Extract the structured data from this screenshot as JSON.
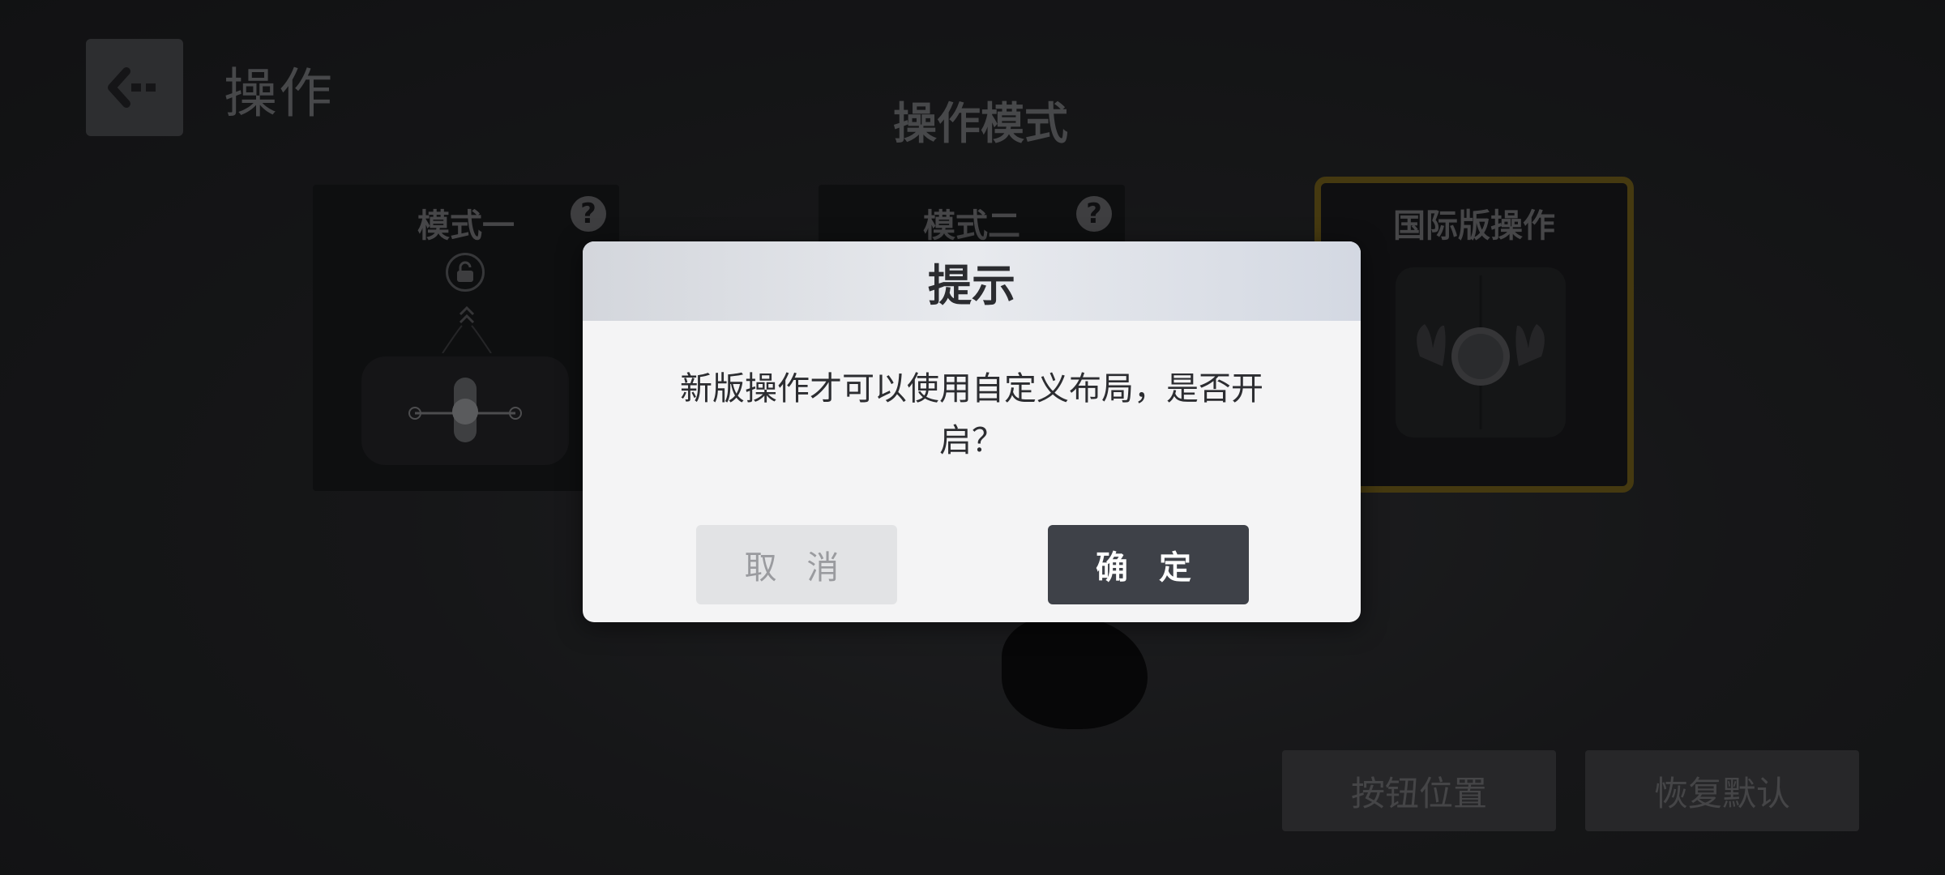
{
  "header": {
    "title": "操作",
    "back_icon": "back-arrow-icon"
  },
  "section": {
    "title": "操作模式"
  },
  "modes": [
    {
      "label": "模式一",
      "help_icon": "?",
      "locked": true
    },
    {
      "label": "模式二",
      "help_icon": "?"
    },
    {
      "label": "国际版操作",
      "selected": true
    }
  ],
  "bottom_buttons": {
    "position": "按钮位置",
    "reset": "恢复默认"
  },
  "dialog": {
    "title": "提示",
    "message": "新版操作才可以使用自定义布局，是否开启？",
    "cancel": "取 消",
    "confirm": "确 定"
  },
  "colors": {
    "selected_border": "#8a7220",
    "confirm_button": "#3e4148"
  }
}
